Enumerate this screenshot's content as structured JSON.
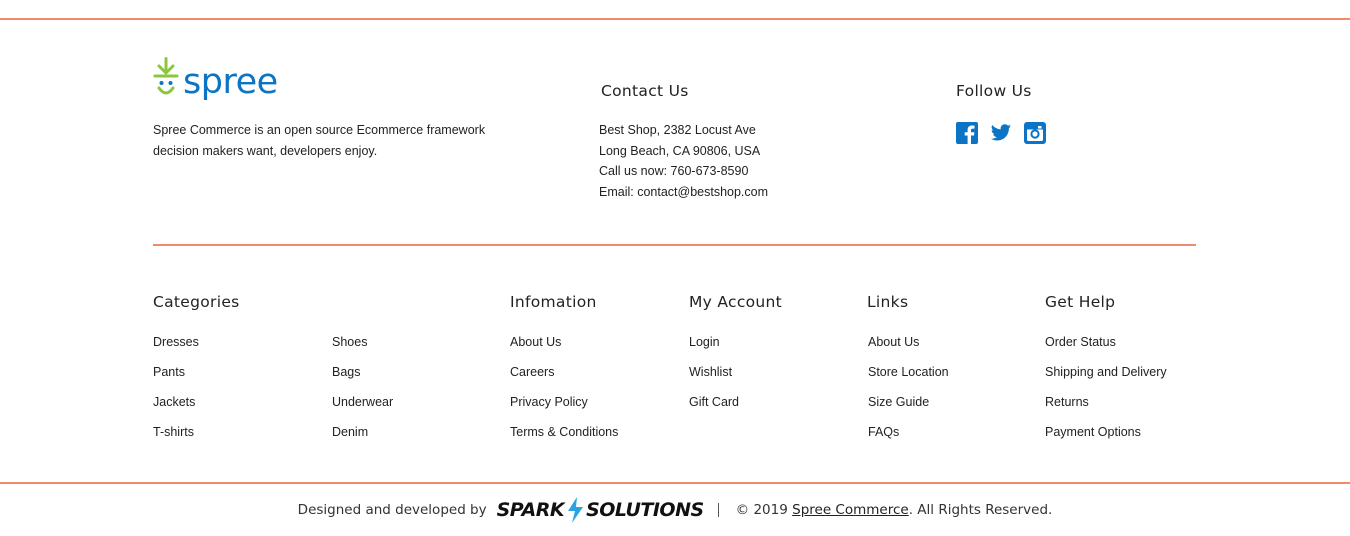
{
  "brand": {
    "name": "spree",
    "accent": "#0b74c4",
    "cart_green": "#8cc63f",
    "rule_color": "#f08a6f"
  },
  "about": {
    "line1": "Spree Commerce is an open source Ecommerce framework",
    "line2": "decision makers want, developers enjoy."
  },
  "contact": {
    "heading": "Contact Us",
    "address1": "Best Shop, 2382 Locust Ave",
    "address2": "Long Beach, CA 90806, USA",
    "phone": "Call us now: 760-673-8590",
    "email": "Email: contact@bestshop.com"
  },
  "follow": {
    "heading": "Follow Us",
    "icons": [
      "facebook-icon",
      "twitter-icon",
      "instagram-icon"
    ]
  },
  "categories": {
    "heading": "Categories",
    "col1": [
      "Dresses",
      "Pants",
      "Jackets",
      "T-shirts"
    ],
    "col2": [
      "Shoes",
      "Bags",
      "Underwear",
      "Denim"
    ]
  },
  "information": {
    "heading": "Infomation",
    "items": [
      "About Us",
      "Careers",
      "Privacy Policy",
      "Terms & Conditions"
    ]
  },
  "account": {
    "heading": "My Account",
    "items": [
      "Login",
      "Wishlist",
      "Gift Card"
    ]
  },
  "links": {
    "heading": "Links",
    "items": [
      "About Us",
      "Store Location",
      "Size Guide",
      "FAQs"
    ]
  },
  "help": {
    "heading": "Get Help",
    "items": [
      "Order Status",
      "Shipping and Delivery",
      "Returns",
      "Payment Options"
    ]
  },
  "credit": {
    "designed_by": "Designed and developed by",
    "spark_left": "SPARK",
    "spark_right": "SOLUTIONS",
    "copyright": "© 2019",
    "company_link": "Spree Commerce",
    "rights": ". All Rights Reserved."
  }
}
